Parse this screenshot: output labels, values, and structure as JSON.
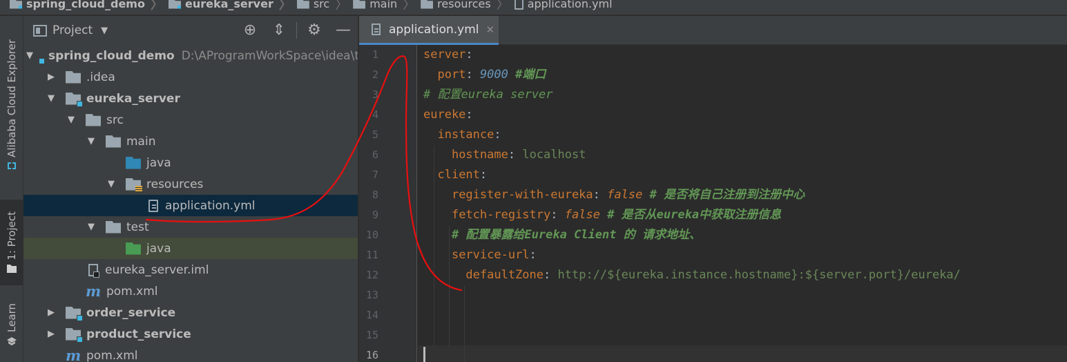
{
  "breadcrumb": [
    {
      "label": "spring_cloud_demo",
      "icon": "module-icon",
      "bold": true
    },
    {
      "label": "eureka_server",
      "icon": "module-icon",
      "bold": true
    },
    {
      "label": "src",
      "icon": "folder-icon"
    },
    {
      "label": "main",
      "icon": "folder-icon"
    },
    {
      "label": "resources",
      "icon": "resources-folder-icon"
    },
    {
      "label": "application.yml",
      "icon": "yml-file-icon"
    }
  ],
  "tool_stripe": {
    "alibaba": "Alibaba Cloud Explorer",
    "project": "1: Project",
    "learn": "Learn"
  },
  "project_panel": {
    "title": "Project",
    "tree": [
      {
        "label": "spring_cloud_demo",
        "path": "D:\\AProgramWorkSpace\\idea\\t",
        "icon": "module-icon",
        "bold": true,
        "expanded": true
      },
      {
        "label": ".idea",
        "icon": "folder-icon",
        "expanded": false
      },
      {
        "label": "eureka_server",
        "icon": "module-icon",
        "bold": true,
        "expanded": true
      },
      {
        "label": "src",
        "icon": "folder-icon",
        "expanded": true
      },
      {
        "label": "main",
        "icon": "folder-icon",
        "expanded": true
      },
      {
        "label": "java",
        "icon": "java-source-folder-icon"
      },
      {
        "label": "resources",
        "icon": "resources-folder-icon",
        "expanded": true
      },
      {
        "label": "application.yml",
        "icon": "yml-file-icon",
        "selected": true
      },
      {
        "label": "test",
        "icon": "folder-icon",
        "expanded": true
      },
      {
        "label": "java",
        "icon": "test-source-folder-icon",
        "highlighted": true
      },
      {
        "label": "eureka_server.iml",
        "icon": "iml-file-icon"
      },
      {
        "label": "pom.xml",
        "icon": "maven-icon"
      },
      {
        "label": "order_service",
        "icon": "module-icon",
        "bold": true,
        "expanded": false
      },
      {
        "label": "product_service",
        "icon": "module-icon",
        "bold": true,
        "expanded": false
      },
      {
        "label": "pom.xml",
        "icon": "maven-icon"
      }
    ]
  },
  "editor": {
    "tab_label": "application.yml",
    "current_line": 16,
    "line_numbers": [
      "1",
      "2",
      "3",
      "4",
      "5",
      "6",
      "7",
      "8",
      "9",
      "10",
      "11",
      "12",
      "13",
      "14",
      "15",
      "16"
    ],
    "lines": {
      "l1": {
        "key": "server",
        "colon": ":"
      },
      "l2": {
        "key": "port",
        "colon": ":",
        "value": "9000",
        "comment": "#端口"
      },
      "l3": {
        "comment": "# 配置eureka server"
      },
      "l4": {
        "key": "eureke",
        "colon": ":"
      },
      "l5": {
        "key": "instance",
        "colon": ":"
      },
      "l6": {
        "key": "hostname",
        "colon": ":",
        "value": "localhost"
      },
      "l7": {
        "key": "client",
        "colon": ":"
      },
      "l8": {
        "key": "register-with-eureka",
        "colon": ":",
        "value": "false",
        "comment": "# 是否将自己注册到注册中心"
      },
      "l9": {
        "key": "fetch-registry",
        "colon": ":",
        "value": "false",
        "comment": "# 是否从eureka中获取注册信息"
      },
      "l10": {
        "comment": "# 配置暴露给Eureka Client 的 请求地址、"
      },
      "l11": {
        "key": "service-url",
        "colon": ":"
      },
      "l12": {
        "key": "defaultZone",
        "colon": ":",
        "value": "http://${eureka.instance.hostname}:${server.port}/eureka/"
      }
    }
  },
  "colors": {
    "keyword": "#cc7832",
    "comment": "#629755",
    "number": "#6897bb",
    "string": "#6a8759",
    "selection": "#0d293e",
    "annotation": "#e81010"
  }
}
